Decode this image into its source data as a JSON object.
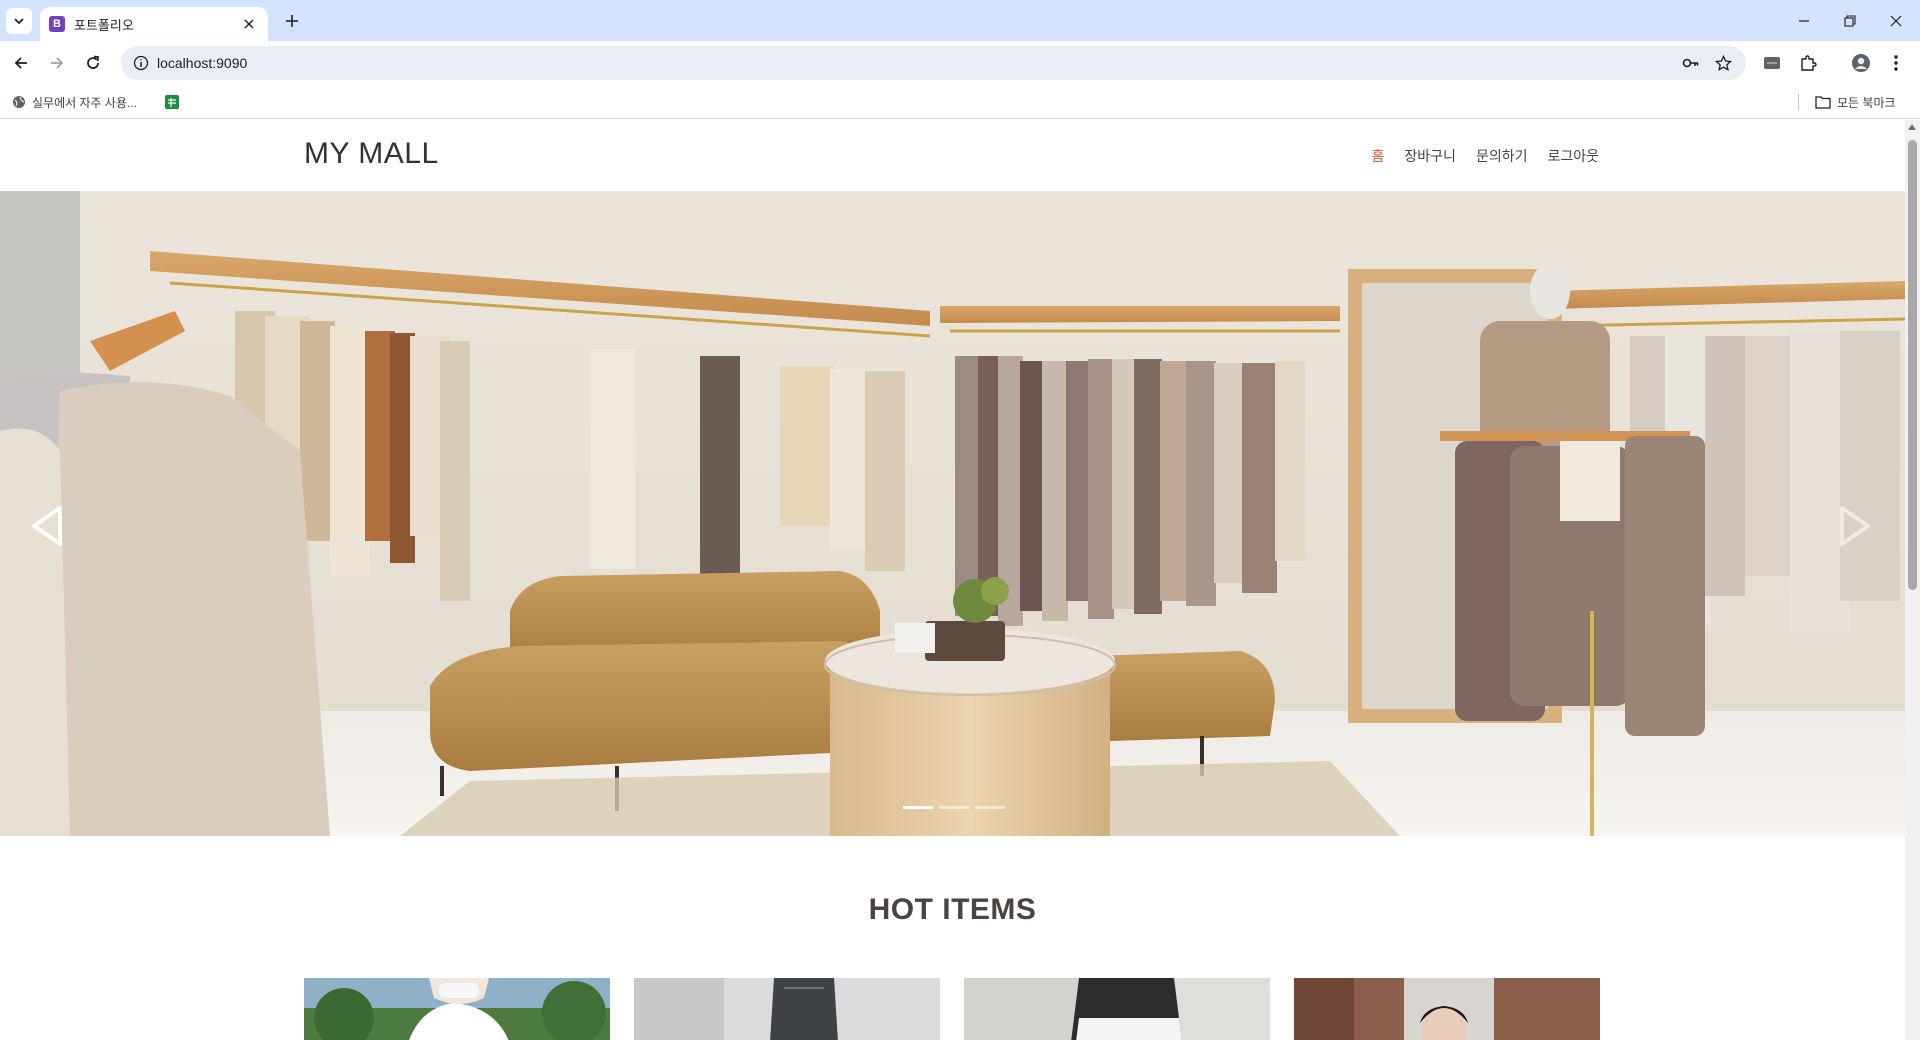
{
  "browser": {
    "tab": {
      "favicon": "B",
      "title": "포트폴리오"
    },
    "url": "localhost:9090",
    "bookmarks": {
      "item1": "실무에서 자주 사용...",
      "all_bookmarks": "모든 북마크"
    },
    "icons": {
      "tab_search": "chevron-down-icon",
      "new_tab": "plus-icon",
      "back": "arrow-left-icon",
      "forward": "arrow-right-icon",
      "reload": "reload-icon",
      "site_info": "info-icon",
      "password": "key-icon",
      "bookmark": "star-icon",
      "extensions": "puzzle-icon",
      "profile": "profile-icon",
      "menu": "kebab-icon"
    }
  },
  "site": {
    "brand": "MY MALL",
    "nav": [
      {
        "label": "홈",
        "active": true
      },
      {
        "label": "장바구니",
        "active": false
      },
      {
        "label": "문의하기",
        "active": false
      },
      {
        "label": "로그아웃",
        "active": false
      }
    ],
    "carousel": {
      "slide_count": 3,
      "active_index": 0
    },
    "section_title": "HOT ITEMS",
    "products_visible": 4
  },
  "colors": {
    "chrome_tabstrip": "#d3e3fd",
    "omnibox": "#e9eef6",
    "nav_active": "#e8553c",
    "heading": "#4a4340"
  }
}
